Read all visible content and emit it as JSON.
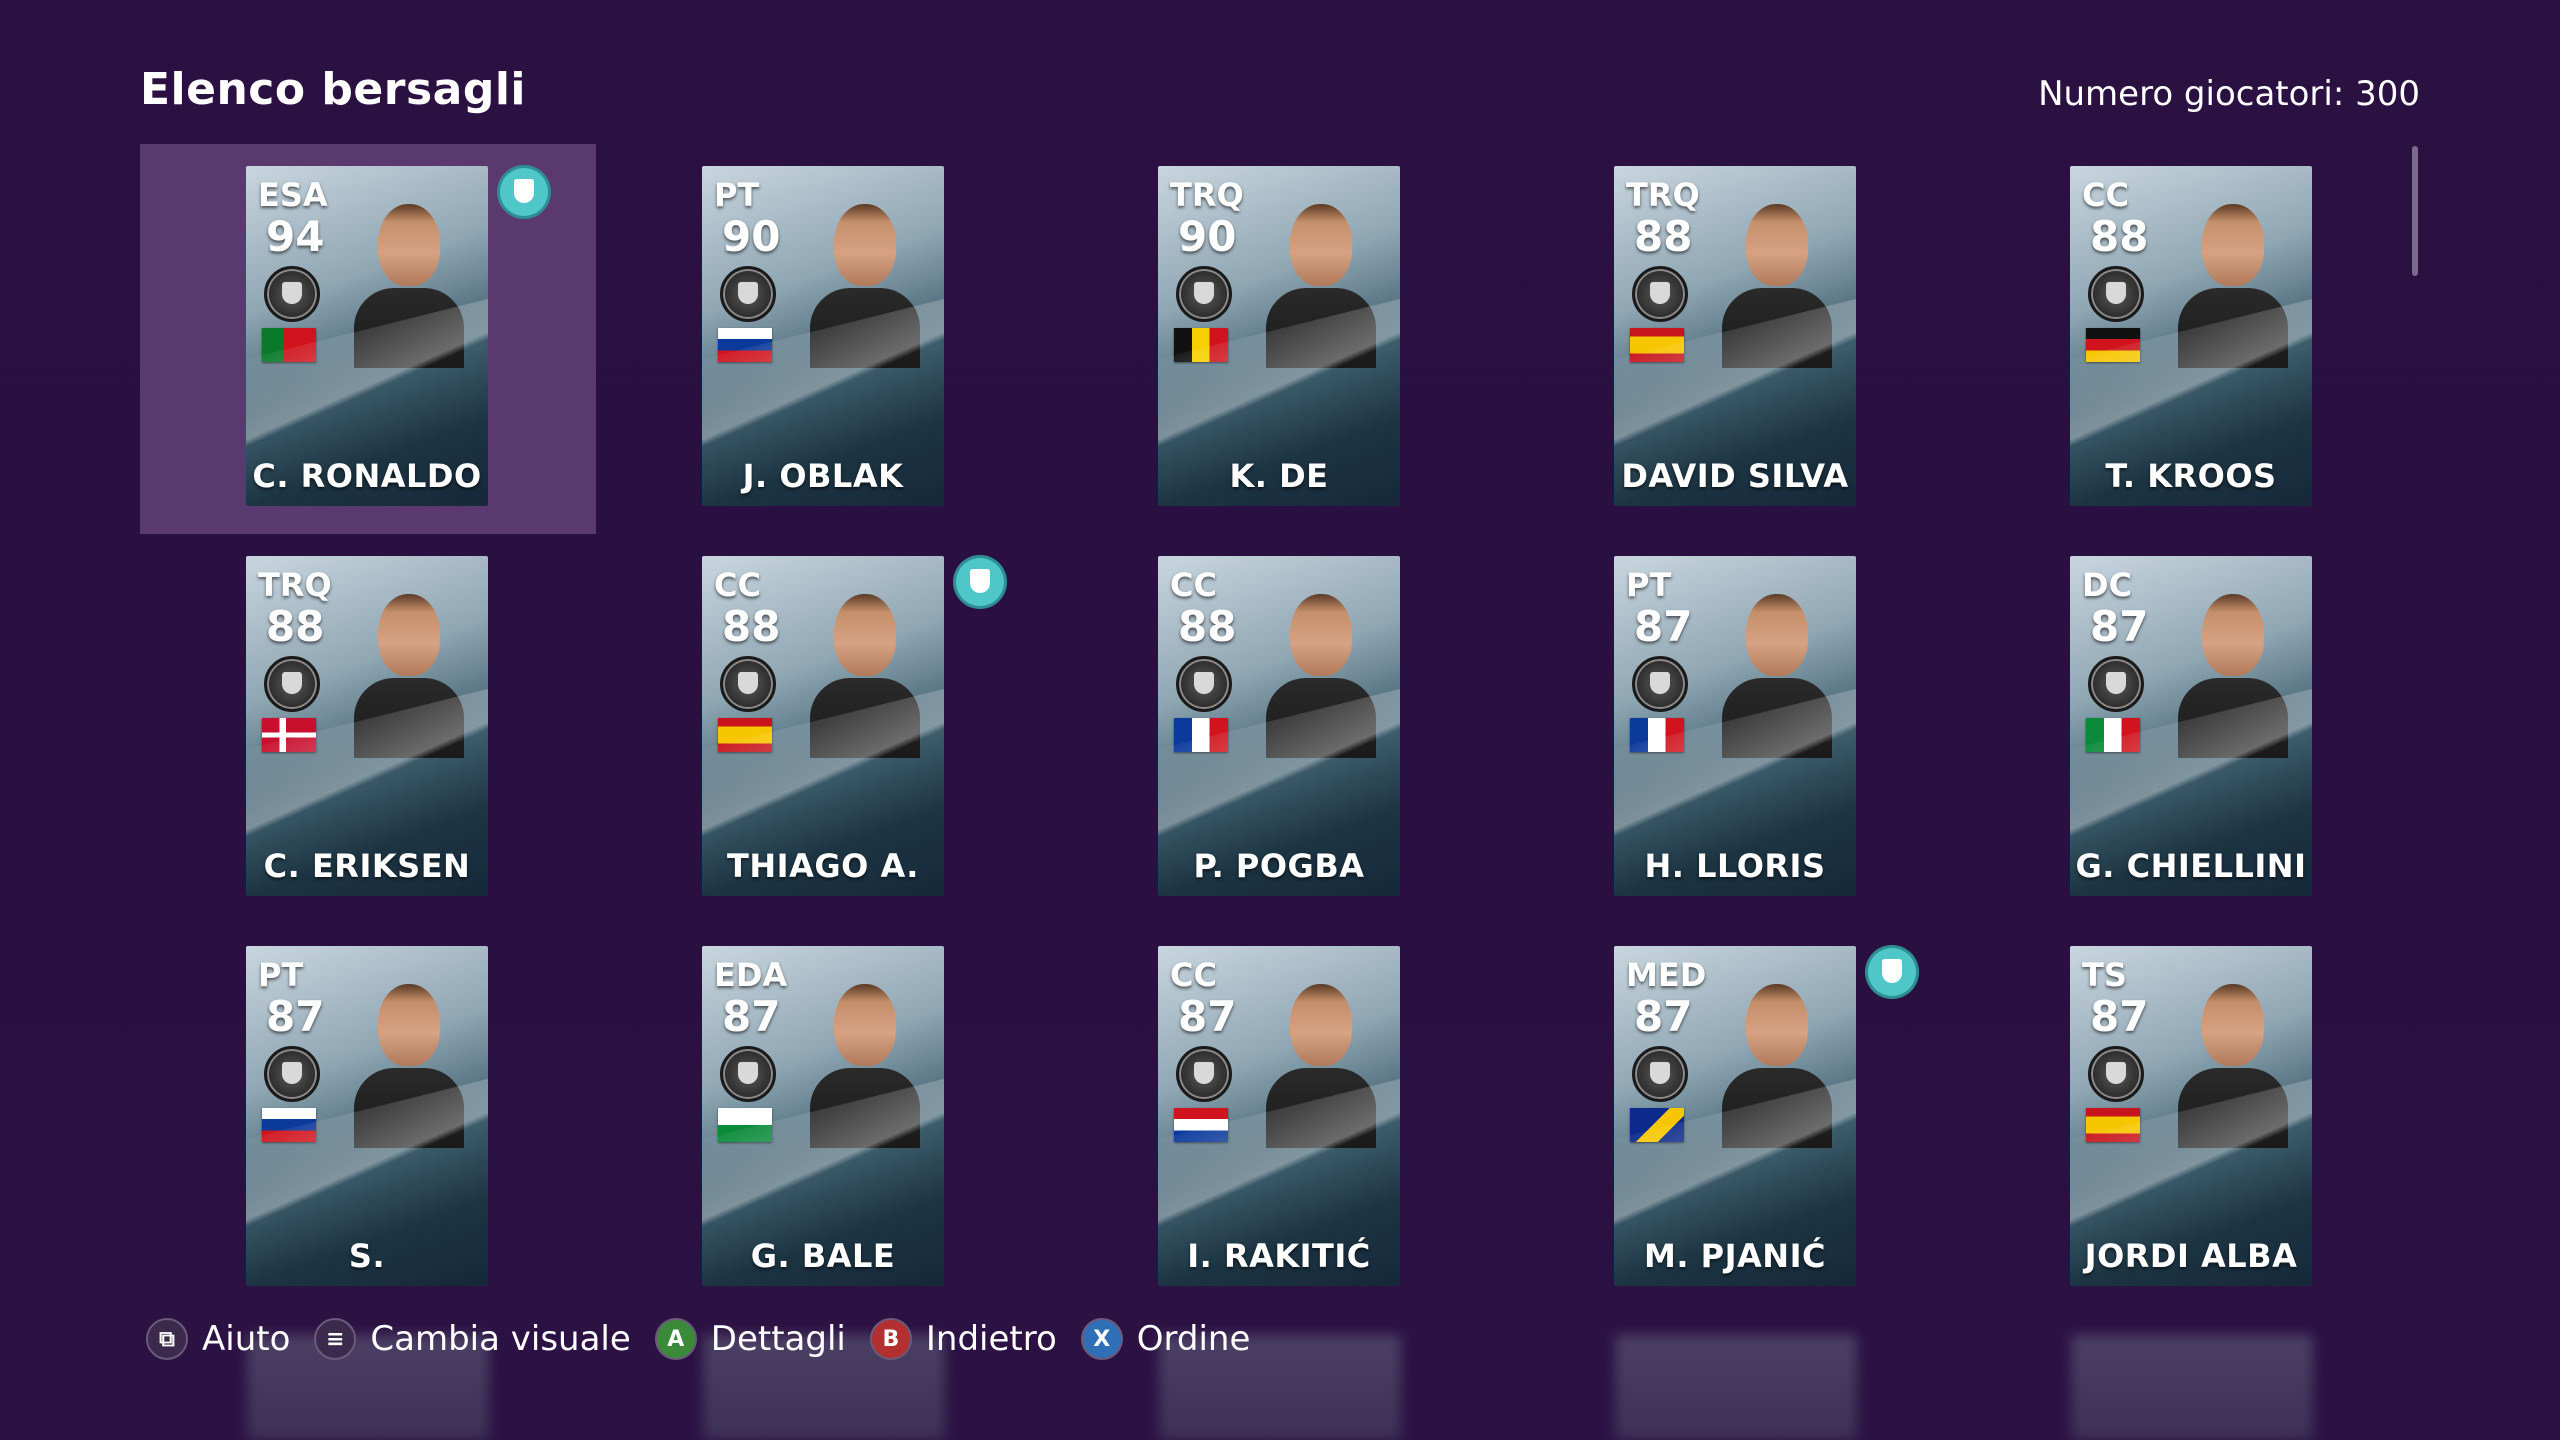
{
  "header": {
    "title": "Elenco bersagli",
    "player_count": "Numero giocatori: 300"
  },
  "players": [
    {
      "pos": "ESA",
      "ovr": "94",
      "name": "C. RONALDO",
      "flag": "portugal",
      "selected": true,
      "shield": true
    },
    {
      "pos": "PT",
      "ovr": "90",
      "name": "J. OBLAK",
      "flag": "slovenia",
      "selected": false,
      "shield": false
    },
    {
      "pos": "TRQ",
      "ovr": "90",
      "name": "K. DE BRUYNE",
      "flag": "belgium",
      "selected": false,
      "shield": false
    },
    {
      "pos": "TRQ",
      "ovr": "88",
      "name": "DAVID SILVA",
      "flag": "spain",
      "selected": false,
      "shield": false
    },
    {
      "pos": "CC",
      "ovr": "88",
      "name": "T. KROOS",
      "flag": "germany",
      "selected": false,
      "shield": false
    },
    {
      "pos": "TRQ",
      "ovr": "88",
      "name": "C. ERIKSEN",
      "flag": "denmark",
      "selected": false,
      "shield": false
    },
    {
      "pos": "CC",
      "ovr": "88",
      "name": "THIAGO A.",
      "flag": "spain",
      "selected": false,
      "shield": true
    },
    {
      "pos": "CC",
      "ovr": "88",
      "name": "P. POGBA",
      "flag": "france",
      "selected": false,
      "shield": false
    },
    {
      "pos": "PT",
      "ovr": "87",
      "name": "H. LLORIS",
      "flag": "france",
      "selected": false,
      "shield": false
    },
    {
      "pos": "DC",
      "ovr": "87",
      "name": "G. CHIELLINI",
      "flag": "italy",
      "selected": false,
      "shield": false
    },
    {
      "pos": "PT",
      "ovr": "87",
      "name": "S. HANDANOVIČ",
      "flag": "slovenia",
      "selected": false,
      "shield": false
    },
    {
      "pos": "EDA",
      "ovr": "87",
      "name": "G. BALE",
      "flag": "wales",
      "selected": false,
      "shield": false
    },
    {
      "pos": "CC",
      "ovr": "87",
      "name": "I. RAKITIĆ",
      "flag": "croatia",
      "selected": false,
      "shield": false
    },
    {
      "pos": "MED",
      "ovr": "87",
      "name": "M. PJANIĆ",
      "flag": "bosnia",
      "selected": false,
      "shield": true
    },
    {
      "pos": "TS",
      "ovr": "87",
      "name": "JORDI ALBA",
      "flag": "spain",
      "selected": false,
      "shield": false
    }
  ],
  "footer": {
    "hints": [
      {
        "key": "⧉",
        "label": "Aiuto",
        "color": "#3b2a4c",
        "icon": "help-button-icon"
      },
      {
        "key": "≡",
        "label": "Cambia visuale",
        "color": "#3b2a4c",
        "icon": "menu-button-icon"
      },
      {
        "key": "A",
        "label": "Dettagli",
        "color": "#3a8a3a",
        "icon": "a-button-icon"
      },
      {
        "key": "B",
        "label": "Indietro",
        "color": "#b23030",
        "icon": "b-button-icon"
      },
      {
        "key": "X",
        "label": "Ordine",
        "color": "#2f6fb5",
        "icon": "x-button-icon"
      }
    ]
  },
  "colors": {
    "background": "#2a1040",
    "selected_cell": "#5a3a6e",
    "shield": "#4fc6c8"
  }
}
